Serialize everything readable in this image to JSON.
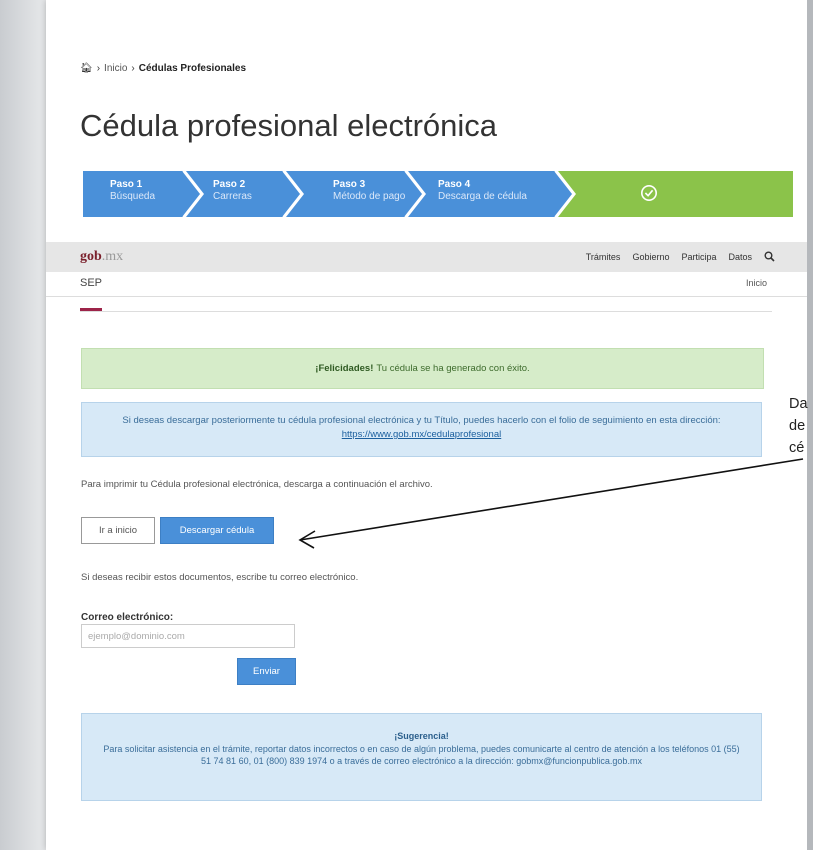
{
  "breadcrumb": {
    "home_icon": "home-icon",
    "sep": "›",
    "inicio": "Inicio",
    "current": "Cédulas Profesionales"
  },
  "page": {
    "title": "Cédula profesional electrónica"
  },
  "steps": [
    {
      "title": "Paso 1",
      "subtitle": "Búsqueda"
    },
    {
      "title": "Paso 2",
      "subtitle": "Carreras"
    },
    {
      "title": "Paso 3",
      "subtitle": "Método de pago"
    },
    {
      "title": "Paso 4",
      "subtitle": "Descarga de cédula"
    }
  ],
  "steps_final_icon": "check-circle-icon",
  "colors": {
    "step_blue": "#4a90d9",
    "step_green": "#8bc34a",
    "brand_red": "#9d2449",
    "info_bg": "#d7e9f7",
    "success_bg": "#d6ecc9"
  },
  "navbar": {
    "logo_gob": "gob",
    "logo_mx": ".mx",
    "items": [
      "Trámites",
      "Gobierno",
      "Participa",
      "Datos"
    ],
    "search_icon": "search-icon"
  },
  "subbar": {
    "org": "SEP",
    "inicio": "Inicio"
  },
  "success": {
    "bold": "¡Felicidades!",
    "text": "Tu cédula se ha generado con éxito."
  },
  "info": {
    "text": "Si deseas descargar posteriormente tu cédula profesional electrónica y tu Título, puedes hacerlo con el folio de seguimiento en esta dirección:",
    "link": "https://www.gob.mx/cedulaprofesional"
  },
  "print_text": "Para imprimir tu Cédula profesional electrónica, descarga a continuación el archivo.",
  "buttons": {
    "home": "Ir a inicio",
    "download": "Descargar cédula",
    "send": "Enviar"
  },
  "receive_text": "Si deseas recibir estos documentos, escribe tu correo electrónico.",
  "email": {
    "label": "Correo electrónico:",
    "placeholder": "ejemplo@dominio.com",
    "value": ""
  },
  "suggestion": {
    "title": "¡Sugerencia!",
    "text": "Para solicitar asistencia en el trámite, reportar datos incorrectos o en caso de algún problema, puedes comunicarte al centro de atención a los teléfonos 01 (55) 51 74 81 60, 01 (800) 839 1974 o a través de correo electrónico a la dirección: gobmx@funcionpublica.gob.mx"
  },
  "callout": {
    "line1": "Da",
    "line2": "de",
    "line3": "cé"
  }
}
